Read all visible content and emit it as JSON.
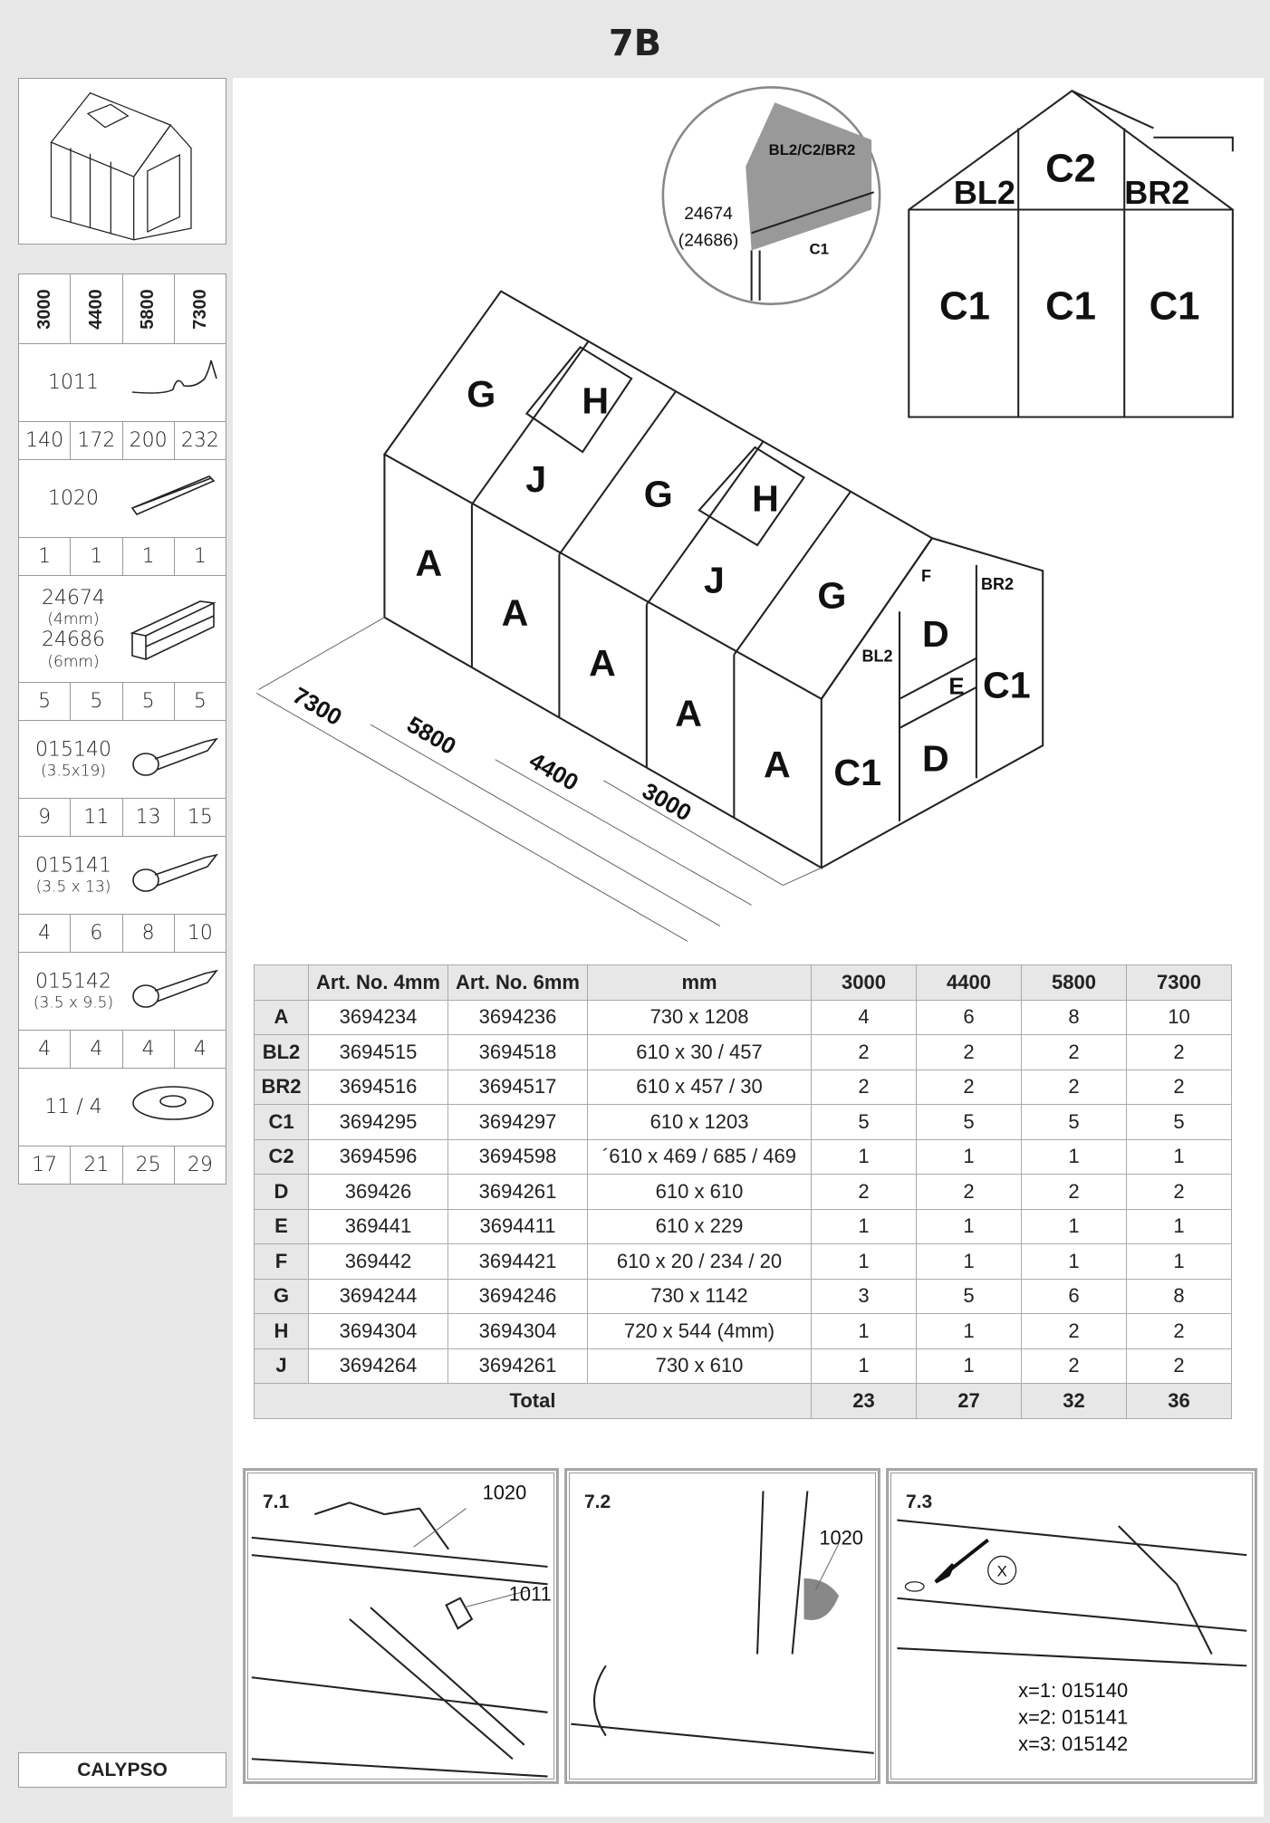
{
  "page_title": "7B",
  "brand": "CALYPSO",
  "parts": {
    "sizes": [
      "3000",
      "4400",
      "5800",
      "7300"
    ],
    "items": [
      {
        "name": "1011",
        "sub": "",
        "icon": "wire-clip-icon",
        "counts": [
          "140",
          "172",
          "200",
          "232"
        ]
      },
      {
        "name": "1020",
        "sub": "",
        "icon": "rubber-profile-icon",
        "counts": [
          "1",
          "1",
          "1",
          "1"
        ]
      },
      {
        "name": "24674",
        "sub": "(4mm)",
        "name2": "24686",
        "sub2": "(6mm)",
        "icon": "h-profile-icon",
        "counts": [
          "5",
          "5",
          "5",
          "5"
        ]
      },
      {
        "name": "015140",
        "sub": "(3.5x19)",
        "icon": "screw-icon",
        "counts": [
          "9",
          "11",
          "13",
          "15"
        ]
      },
      {
        "name": "015141",
        "sub": "(3.5 x 13)",
        "icon": "screw-icon",
        "counts": [
          "4",
          "6",
          "8",
          "10"
        ]
      },
      {
        "name": "015142",
        "sub": "(3.5 x 9.5)",
        "icon": "screw-icon",
        "counts": [
          "4",
          "4",
          "4",
          "4"
        ]
      },
      {
        "name": "11 / 4",
        "sub": "",
        "icon": "washer-icon",
        "counts": [
          "17",
          "21",
          "25",
          "29"
        ]
      }
    ]
  },
  "drawing": {
    "roof": [
      "G",
      "H",
      "J",
      "G",
      "H",
      "J",
      "G"
    ],
    "walls": [
      "A",
      "A",
      "A",
      "A",
      "A"
    ],
    "end": {
      "c1_front": "C1",
      "d_top": "D",
      "e": "E",
      "d_bottom": "D",
      "c1_side": "C1",
      "bl2": "BL2",
      "br2": "BR2",
      "f": "F"
    },
    "dims": [
      "7300",
      "5800",
      "4400",
      "3000"
    ],
    "callout": {
      "panels": "BL2/C2/BR2",
      "art1": "24674",
      "art2": "(24686)",
      "c1": "C1"
    },
    "elevation": {
      "c2": "C2",
      "bl2": "BL2",
      "br2": "BR2",
      "c1": [
        "C1",
        "C1",
        "C1"
      ]
    }
  },
  "table": {
    "headers": [
      "",
      "Art. No. 4mm",
      "Art. No. 6mm",
      "mm",
      "3000",
      "4400",
      "5800",
      "7300"
    ],
    "rows": [
      [
        "A",
        "3694234",
        "3694236",
        "730 x 1208",
        "4",
        "6",
        "8",
        "10"
      ],
      [
        "BL2",
        "3694515",
        "3694518",
        "610 x 30 / 457",
        "2",
        "2",
        "2",
        "2"
      ],
      [
        "BR2",
        "3694516",
        "3694517",
        "610 x 457 / 30",
        "2",
        "2",
        "2",
        "2"
      ],
      [
        "C1",
        "3694295",
        "3694297",
        "610 x 1203",
        "5",
        "5",
        "5",
        "5"
      ],
      [
        "C2",
        "3694596",
        "3694598",
        "´610 x 469 / 685 / 469",
        "1",
        "1",
        "1",
        "1"
      ],
      [
        "D",
        "369426",
        "3694261",
        "610 x 610",
        "2",
        "2",
        "2",
        "2"
      ],
      [
        "E",
        "369441",
        "3694411",
        "610 x 229",
        "1",
        "1",
        "1",
        "1"
      ],
      [
        "F",
        "369442",
        "3694421",
        "610 x 20 / 234 / 20",
        "1",
        "1",
        "1",
        "1"
      ],
      [
        "G",
        "3694244",
        "3694246",
        "730 x 1142",
        "3",
        "5",
        "6",
        "8"
      ],
      [
        "H",
        "3694304",
        "3694304",
        "720 x 544 (4mm)",
        "1",
        "1",
        "2",
        "2"
      ],
      [
        "J",
        "3694264",
        "3694261",
        "730 x 610",
        "1",
        "1",
        "2",
        "2"
      ]
    ],
    "total_label": "Total",
    "totals": [
      "23",
      "27",
      "32",
      "36"
    ]
  },
  "panels": [
    {
      "label": "7.1",
      "callouts": [
        "1020",
        "1011"
      ]
    },
    {
      "label": "7.2",
      "callouts": [
        "1020"
      ]
    },
    {
      "label": "7.3",
      "marker": "X",
      "notes": [
        "x=1: 015140",
        "x=2: 015141",
        "x=3: 015142"
      ]
    }
  ]
}
